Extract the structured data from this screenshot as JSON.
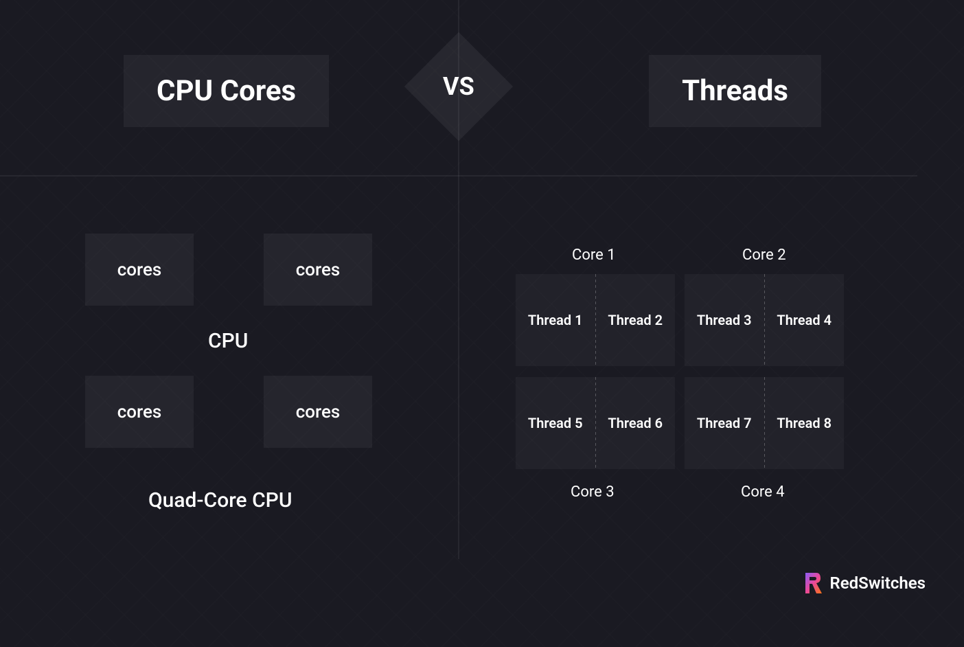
{
  "header": {
    "left_title": "CPU Cores",
    "vs": "VS",
    "right_title": "Threads"
  },
  "left": {
    "cores": [
      "cores",
      "cores",
      "cores",
      "cores"
    ],
    "cpu_label": "CPU",
    "caption": "Quad-Core CPU"
  },
  "right": {
    "top_headers": [
      "Core 1",
      "Core 2"
    ],
    "bottom_headers": [
      "Core 3",
      "Core 4"
    ],
    "threads": [
      "Thread 1",
      "Thread 2",
      "Thread 3",
      "Thread 4",
      "Thread 5",
      "Thread 6",
      "Thread 7",
      "Thread 8"
    ]
  },
  "brand": {
    "name": "RedSwitches"
  }
}
